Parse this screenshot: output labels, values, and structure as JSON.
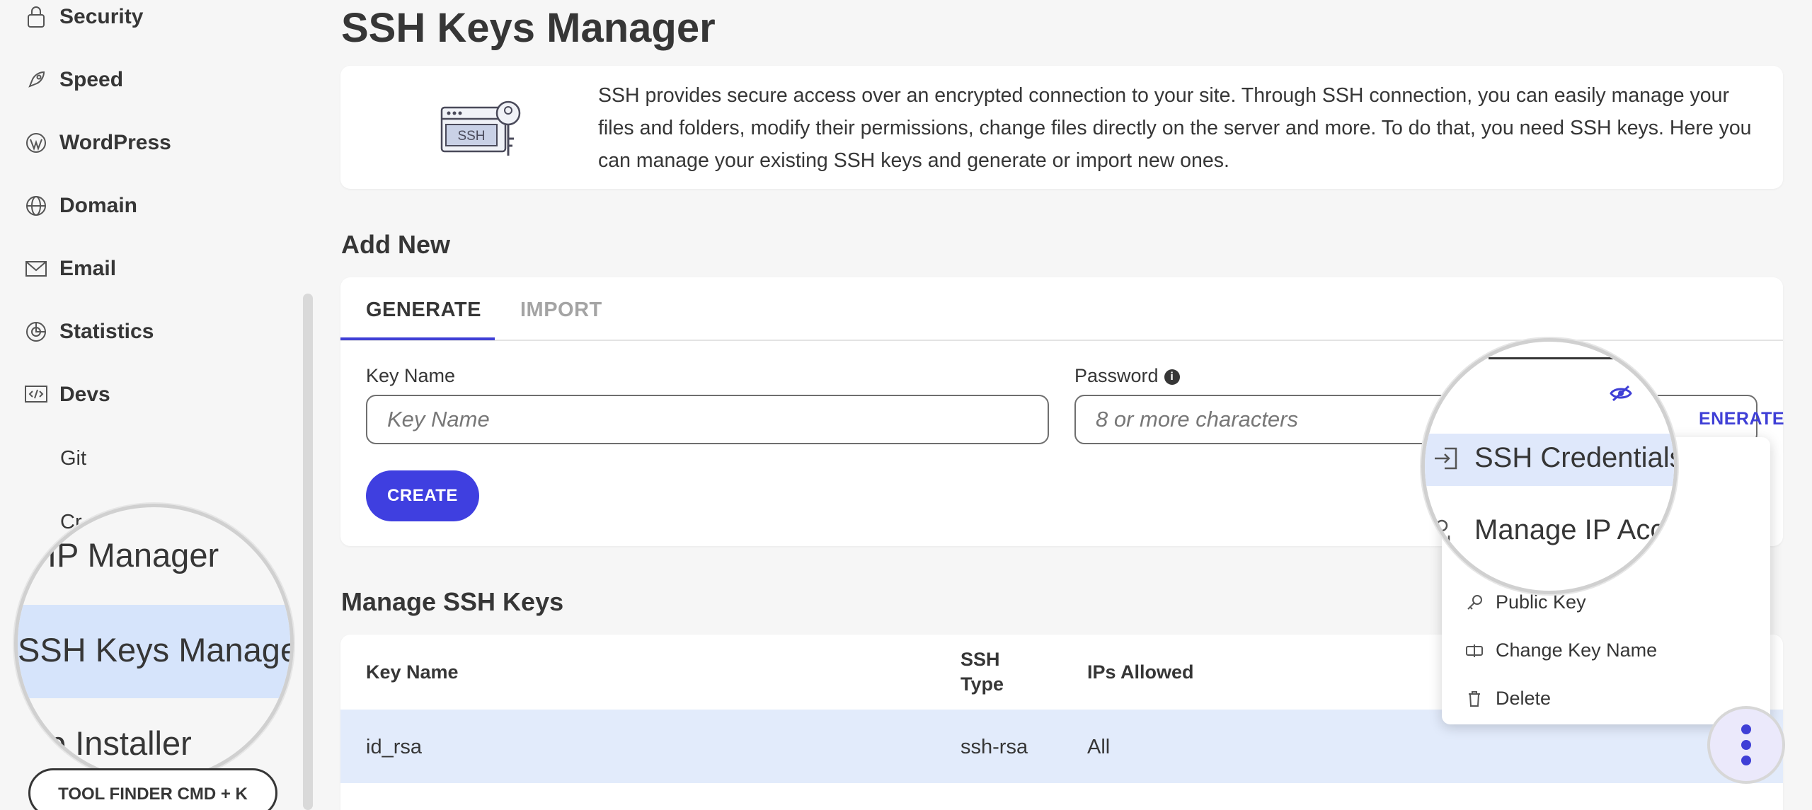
{
  "sidebar": {
    "items": [
      {
        "label": "Security",
        "icon": "lock-icon"
      },
      {
        "label": "Speed",
        "icon": "rocket-icon"
      },
      {
        "label": "WordPress",
        "icon": "wordpress-icon"
      },
      {
        "label": "Domain",
        "icon": "globe-icon"
      },
      {
        "label": "Email",
        "icon": "mail-icon"
      },
      {
        "label": "Statistics",
        "icon": "pie-chart-icon"
      },
      {
        "label": "Devs",
        "icon": "code-icon"
      }
    ],
    "sub_items": [
      "Git",
      "Cr"
    ],
    "magnifier": {
      "prev": "IP Manager",
      "active": "SSH Keys Manager",
      "next": "p Installer"
    },
    "tool_finder": "TOOL FINDER CMD + K"
  },
  "page": {
    "title": "SSH Keys Manager",
    "intro": "SSH provides secure access over an encrypted connection to your site. Through SSH connection, you can easily manage your files and folders, modify their permissions, change files directly on the server and more. To do that, you need SSH keys. Here you can manage your existing SSH keys and generate or import new ones.",
    "illustration_text": "SSH"
  },
  "add_new": {
    "title": "Add New",
    "tabs": [
      "GENERATE",
      "IMPORT"
    ],
    "key_name_label": "Key Name",
    "key_name_placeholder": "Key Name",
    "password_label": "Password",
    "password_placeholder": "8 or more characters",
    "generate_label": "ENERATE",
    "create_label": "CREATE"
  },
  "manage": {
    "title": "Manage SSH Keys",
    "columns": [
      "Key Name",
      "SSH",
      "Type",
      "IPs Allowed"
    ],
    "rows": [
      {
        "key_name": "id_rsa",
        "type": "ssh-rsa",
        "ips": "All"
      }
    ]
  },
  "dropdown": {
    "items": [
      {
        "label": "SSH Credentials",
        "icon": "login-icon"
      },
      {
        "label": "Manage IP Acc",
        "icon": "ip-pin-icon"
      },
      {
        "label": "Public Key",
        "icon": "key-icon"
      },
      {
        "label": "Change Key Name",
        "icon": "rename-icon"
      },
      {
        "label": "Delete",
        "icon": "trash-icon"
      }
    ]
  },
  "colors": {
    "accent": "#3f3fd6",
    "highlight": "#e2ebfb",
    "text": "#363636"
  }
}
